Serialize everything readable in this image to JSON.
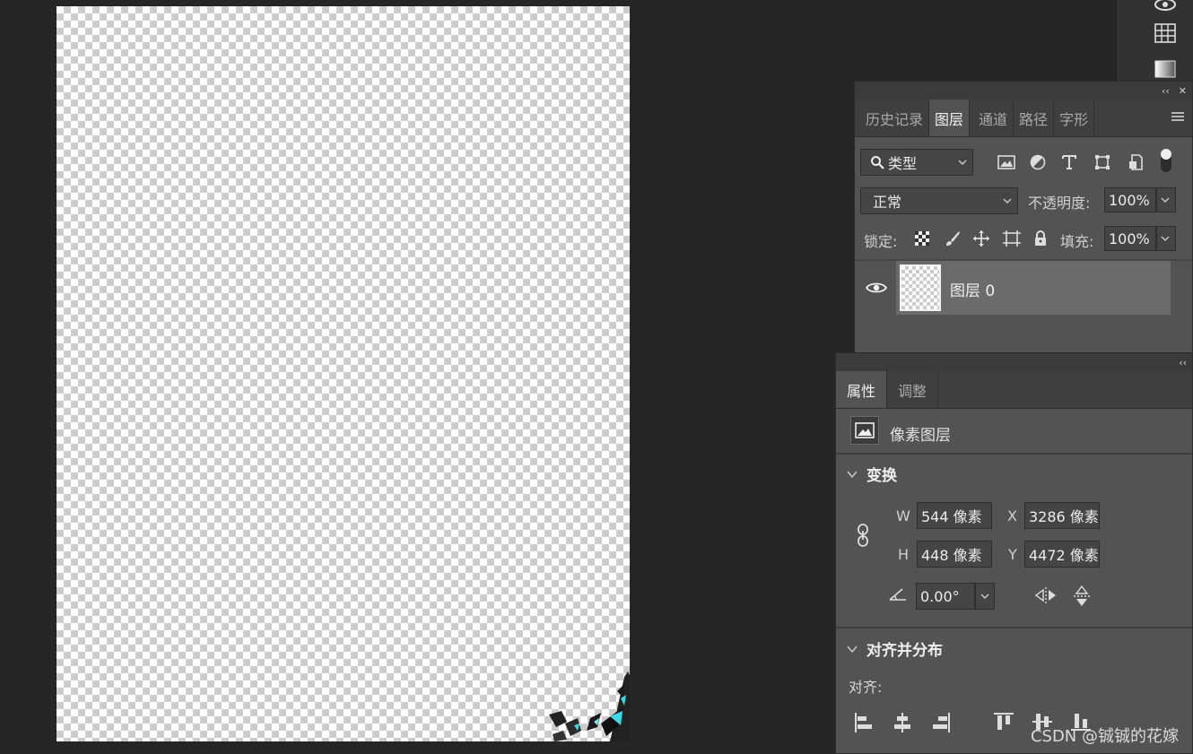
{
  "layers_panel": {
    "tabs": [
      "历史记录",
      "图层",
      "通道",
      "路径",
      "字形"
    ],
    "active_tab": "图层",
    "filter_label": "类型",
    "blend_mode": "正常",
    "opacity_label": "不透明度:",
    "opacity_value": "100%",
    "lock_label": "锁定:",
    "fill_label": "填充:",
    "fill_value": "100%",
    "layers": [
      {
        "name": "图层 0",
        "visible": true
      }
    ],
    "collapse_symbol": "‹‹",
    "close_symbol": "✕"
  },
  "properties_panel": {
    "tabs": [
      "属性",
      "调整"
    ],
    "active_tab": "属性",
    "layer_type": "像素图层",
    "transform_title": "变换",
    "w_label": "W",
    "w_value": "544 像素",
    "h_label": "H",
    "h_value": "448 像素",
    "x_label": "X",
    "x_value": "3286 像素",
    "y_label": "Y",
    "y_value": "4472 像素",
    "angle_value": "0.00°",
    "align_title": "对齐并分布",
    "align_label": "对齐:"
  },
  "watermark": "CSDN @铖铖的花嫁",
  "colors": {
    "accent_canvas_art": "#3fd8e6",
    "panel_bg": "#535353",
    "app_bg": "#262626"
  }
}
